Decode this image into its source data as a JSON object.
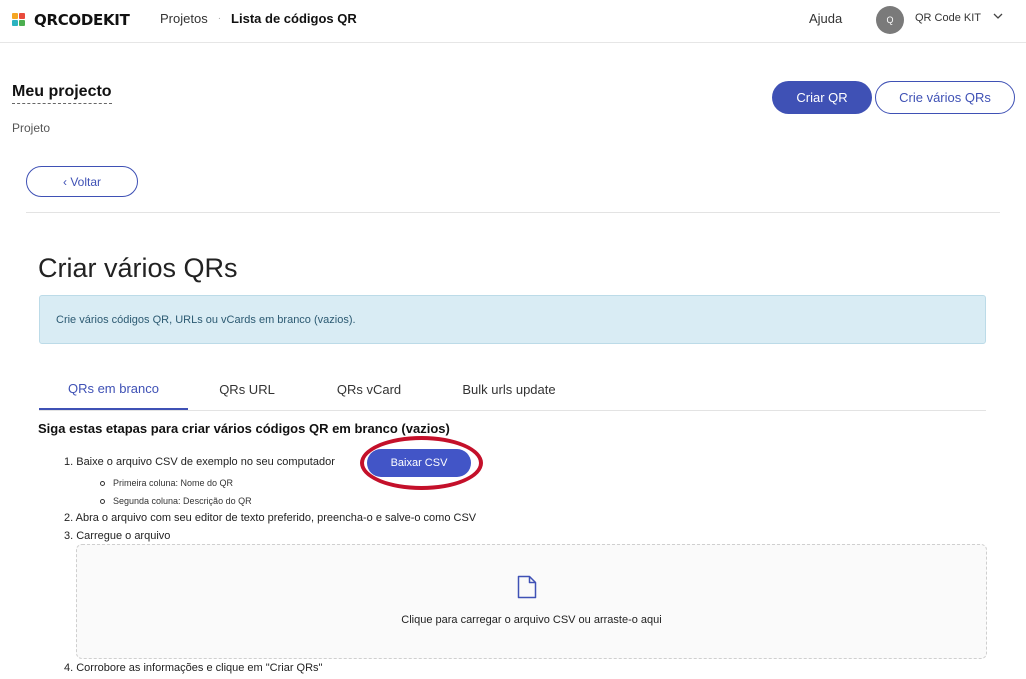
{
  "brand": {
    "logo_text": "QRCODEKIT",
    "logo_colors": [
      "#f5a623",
      "#e94b3c",
      "#2bb3c0",
      "#4caf50"
    ]
  },
  "nav": {
    "breadcrumbs": [
      "Projetos",
      "Lista de códigos QR"
    ],
    "help": "Ajuda",
    "user": {
      "initial": "Q",
      "name": "QR Code KIT"
    }
  },
  "project": {
    "title": "Meu projecto",
    "subtitle": "Projeto",
    "create_qr": "Criar QR",
    "create_many": "Crie vários QRs",
    "back": "‹ Voltar"
  },
  "main": {
    "heading": "Criar vários QRs",
    "info": "Crie vários códigos QR, URLs ou vCards em branco (vazios).",
    "tabs": [
      {
        "label": "QRs em branco",
        "active": true
      },
      {
        "label": "QRs URL",
        "active": false
      },
      {
        "label": "QRs vCard",
        "active": false
      },
      {
        "label": "Bulk urls update",
        "active": false
      }
    ],
    "steps_title": "Siga estas etapas para criar vários códigos QR em branco (vazios)",
    "steps": [
      "1. Baixe o arquivo CSV de exemplo no seu computador",
      "2. Abra o arquivo com seu editor de texto preferido, preencha-o e salve-o como CSV",
      "3. Carregue o arquivo",
      "4. Corrobore as informações e clique em \"Criar QRs\""
    ],
    "sub_steps": [
      "Primeira coluna: Nome do QR",
      "Segunda coluna: Descrição do QR"
    ],
    "csv_button": "Baixar CSV",
    "dropzone_text": "Clique para carregar o arquivo CSV ou arraste-o aqui"
  },
  "colors": {
    "accent": "#3f51b5",
    "info_bg": "#d9ecf4",
    "highlight": "#c4102a"
  }
}
